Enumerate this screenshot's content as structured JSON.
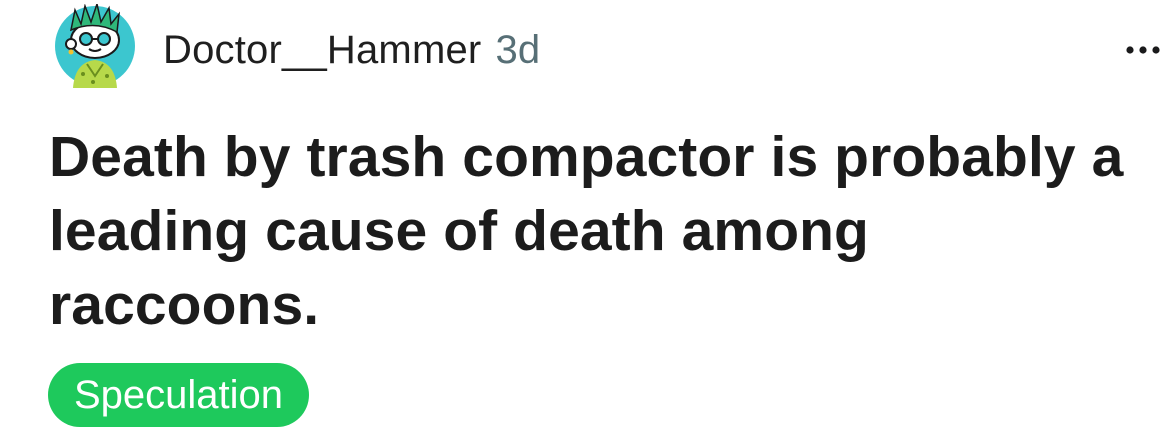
{
  "post": {
    "author": "Doctor__Hammer",
    "age": "3d",
    "title": "Death by trash compactor is probably a leading cause of death among raccoons.",
    "flair": "Speculation",
    "more_icon": "ellipsis-icon"
  },
  "colors": {
    "flair_background": "#1ec95c",
    "flair_text": "#ffffff",
    "avatar_background": "#3cc6cf",
    "timestamp": "#576f76"
  }
}
